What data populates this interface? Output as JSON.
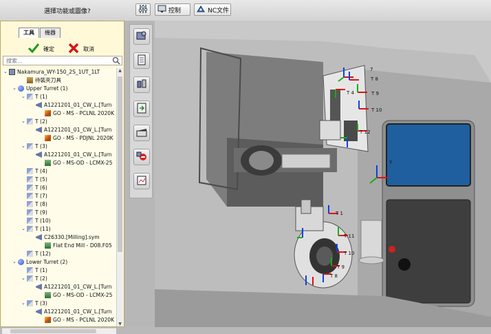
{
  "toolbar": {
    "prompt": "選擇功能或圖像?",
    "control_label": "控制",
    "nc_label": "NC文件"
  },
  "panel": {
    "tabs": [
      {
        "label": "工具"
      },
      {
        "label": "機器"
      }
    ],
    "confirm_label": "確定",
    "cancel_label": "取消",
    "search_placeholder": "搜索..."
  },
  "tree": {
    "rows": [
      {
        "text": "Nakamura_WY-150_2S_1UT_1LT",
        "icon": "machine-icon"
      },
      {
        "text": "待裝夾刀具",
        "icon": "holder-icon"
      },
      {
        "text": "Upper Turret (1)",
        "icon": "turret-icon"
      },
      {
        "text": "T (1)",
        "icon": "slot-icon"
      },
      {
        "text": "A1221201_01_CW_L.[Turn",
        "icon": "tool-icon"
      },
      {
        "text": "GO - MS - PCLNL 2020K",
        "icon": "insert-icon"
      },
      {
        "text": "T (2)",
        "icon": "slot-icon"
      },
      {
        "text": "A1221201_01_CW_L.[Turn",
        "icon": "tool-icon"
      },
      {
        "text": "GO - MS - PDJNL 2020K",
        "icon": "insert-icon"
      },
      {
        "text": "T (3)",
        "icon": "slot-icon"
      },
      {
        "text": "A1221201_01_CW_L.[Turn",
        "icon": "tool-icon"
      },
      {
        "text": "GO - MS-OD - LCMX-25",
        "icon": "item-icon"
      },
      {
        "text": "T (4)",
        "icon": "slot-icon"
      },
      {
        "text": "T (5)",
        "icon": "slot-icon"
      },
      {
        "text": "T (6)",
        "icon": "slot-icon"
      },
      {
        "text": "T (7)",
        "icon": "slot-icon"
      },
      {
        "text": "T (8)",
        "icon": "slot-icon"
      },
      {
        "text": "T (9)",
        "icon": "slot-icon"
      },
      {
        "text": "T (10)",
        "icon": "slot-icon"
      },
      {
        "text": "T (11)",
        "icon": "slot-icon"
      },
      {
        "text": "C26330.[Milling].sym",
        "icon": "tool-icon"
      },
      {
        "text": "Flat End Mill - D08.F05",
        "icon": "item-icon"
      },
      {
        "text": "T (12)",
        "icon": "slot-icon"
      },
      {
        "text": "Lower Turret (2)",
        "icon": "turret-icon"
      },
      {
        "text": "T (1)",
        "icon": "slot-icon"
      },
      {
        "text": "T (2)",
        "icon": "slot-icon"
      },
      {
        "text": "A1221201_01_CW_L.[Turn",
        "icon": "tool-icon"
      },
      {
        "text": "GO - MS-OD - LCMX-25",
        "icon": "item-icon"
      },
      {
        "text": "T (3)",
        "icon": "slot-icon"
      },
      {
        "text": "A1221201_01_CW_L.[Turn",
        "icon": "tool-icon"
      },
      {
        "text": "GO - MS - PCLNL 2020K",
        "icon": "insert-icon"
      }
    ]
  },
  "vtoolbar": {
    "icons": [
      "machine-view-icon",
      "document-icon",
      "tool-settings-icon",
      "transfer-icon",
      "clapperboard-icon",
      "no-entry-icon",
      "report-icon"
    ]
  },
  "viewport": {
    "upper_labels": [
      "7",
      "T 8",
      "T 9",
      "T 10",
      "T 4",
      "T 12"
    ],
    "lower_labels": [
      "T 1",
      "T 11",
      "T 10",
      "T 9",
      "T 8"
    ],
    "axis_label": "Y",
    "colors": {
      "panel_bg": "#fff9d8",
      "enclosure_gray": "#9c9c9c",
      "screen_blue": "#1f5fa0",
      "axis_red": "#e01010",
      "axis_green": "#10b010",
      "axis_blue": "#1040e0"
    }
  }
}
